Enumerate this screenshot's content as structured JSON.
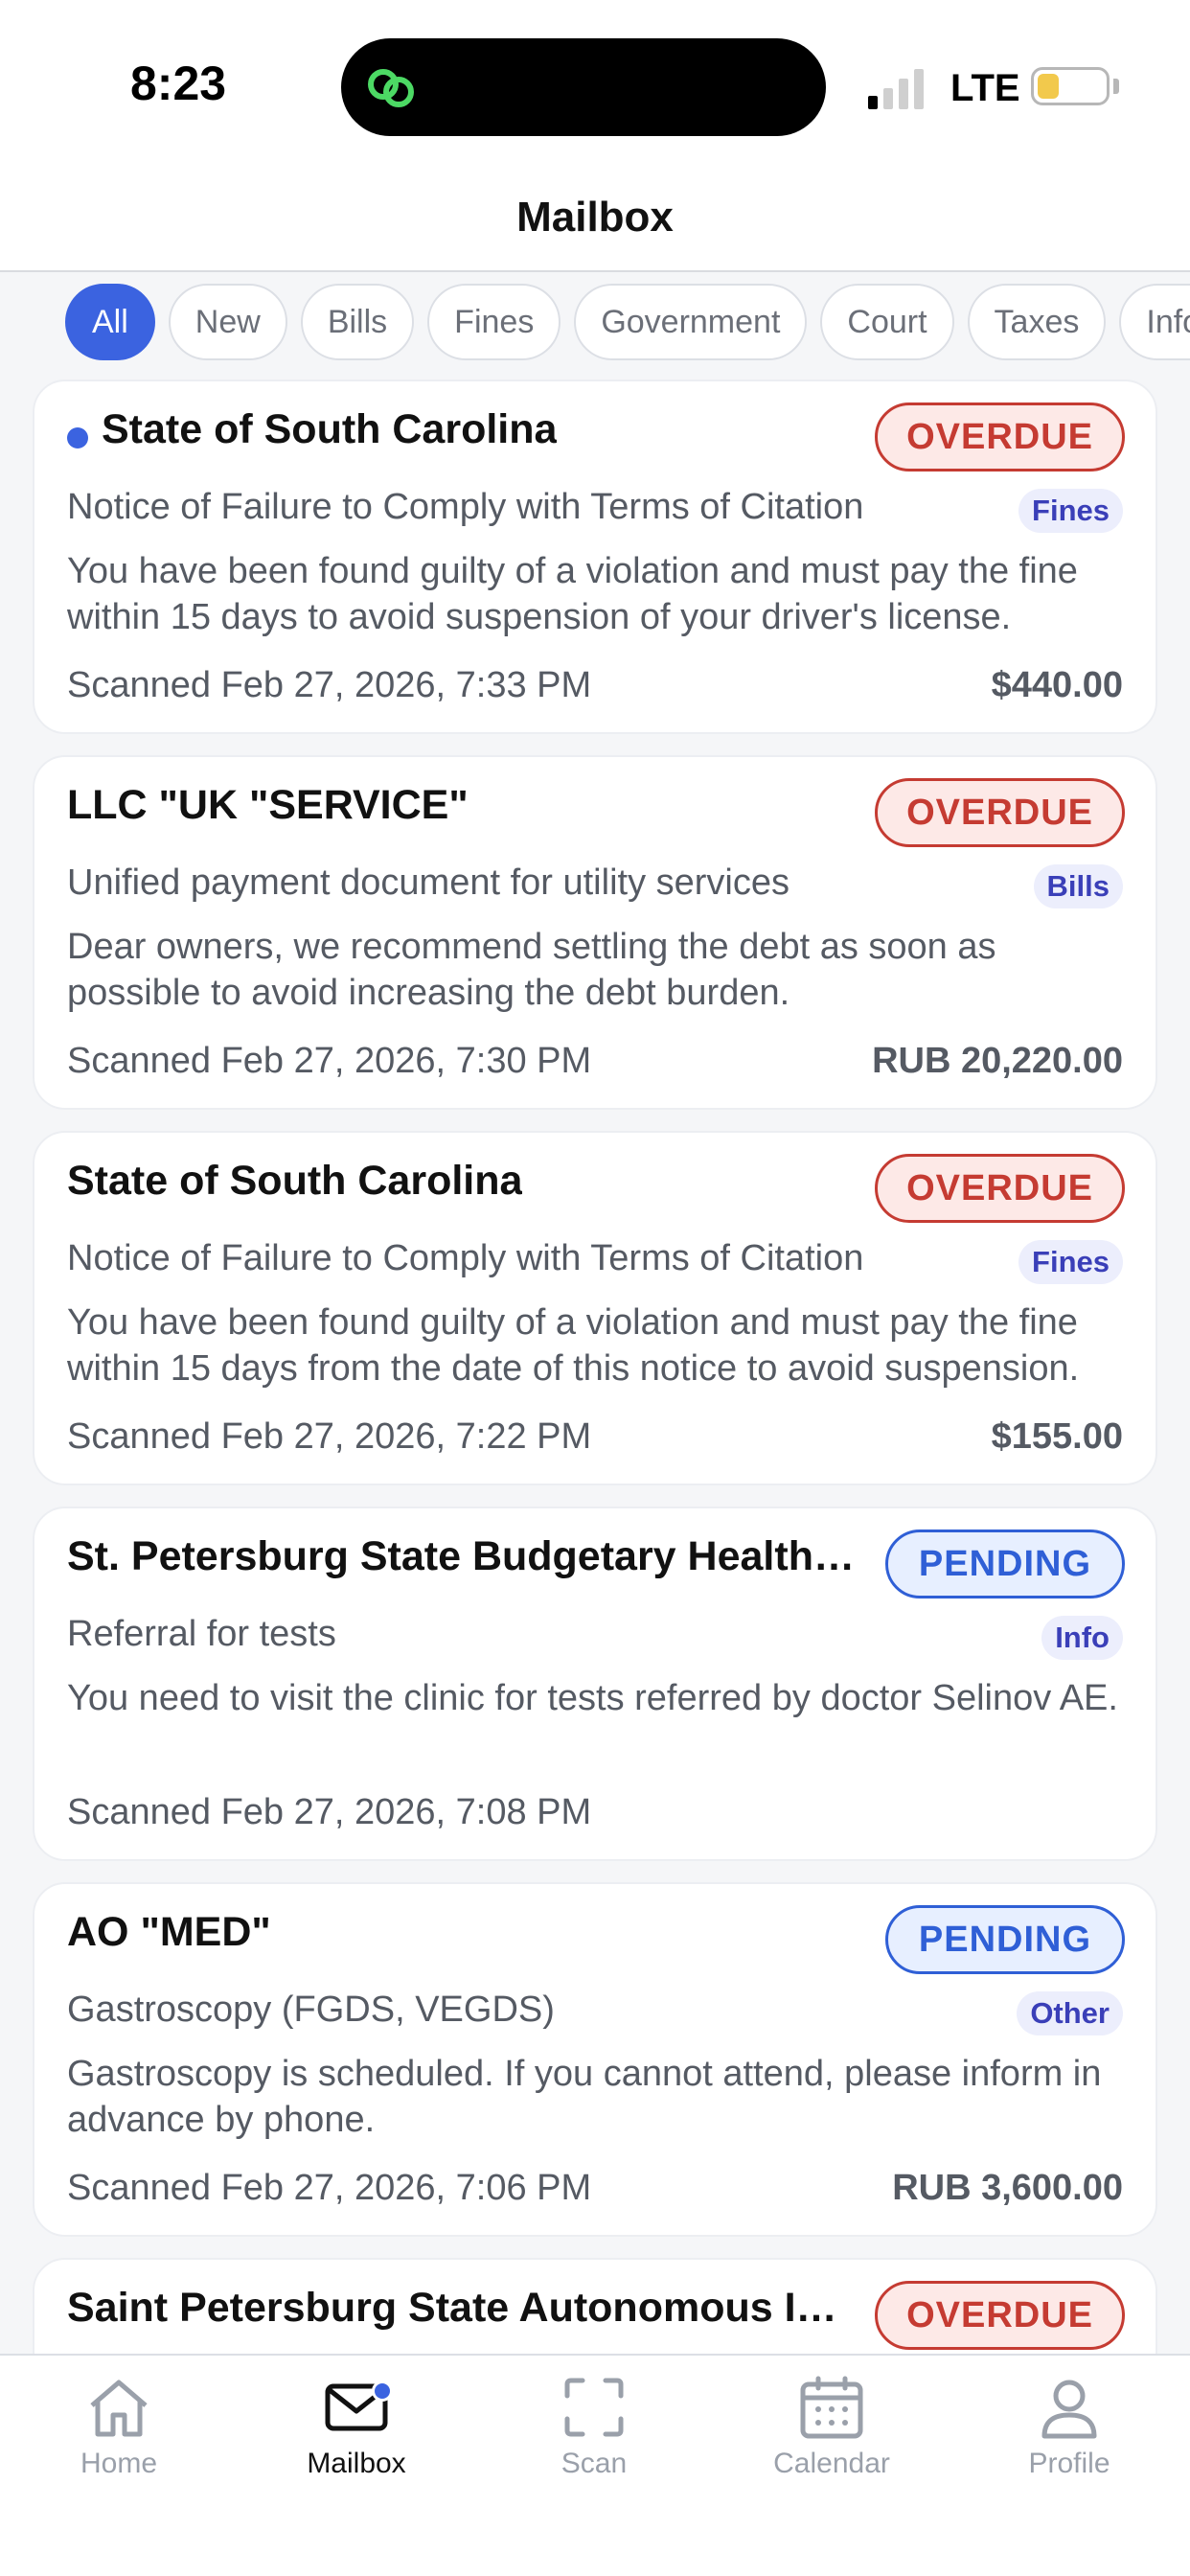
{
  "status_bar": {
    "time": "8:23",
    "network": "LTE"
  },
  "nav": {
    "title": "Mailbox"
  },
  "filters": [
    {
      "label": "All",
      "active": true
    },
    {
      "label": "New",
      "active": false
    },
    {
      "label": "Bills",
      "active": false
    },
    {
      "label": "Fines",
      "active": false
    },
    {
      "label": "Government",
      "active": false
    },
    {
      "label": "Court",
      "active": false
    },
    {
      "label": "Taxes",
      "active": false
    },
    {
      "label": "Info",
      "active": false
    }
  ],
  "messages": [
    {
      "sender": "State of South Carolina",
      "unread": true,
      "status": "OVERDUE",
      "subject": "Notice of Failure to Comply with Terms of Citation",
      "tag": "Fines",
      "body": "You have been found guilty of a violation and must pay the fine within 15 days to avoid suspension of your driver's license.",
      "date": "Scanned Feb 27, 2026, 7:33 PM",
      "amount": "$440.00"
    },
    {
      "sender": "LLC \"UK \"SERVICE\"",
      "unread": false,
      "status": "OVERDUE",
      "subject": "Unified payment document for utility services",
      "tag": "Bills",
      "body": "Dear owners, we recommend settling the debt as soon as possible to avoid increasing the debt burden.",
      "date": "Scanned Feb 27, 2026, 7:30 PM",
      "amount": "RUB 20,220.00"
    },
    {
      "sender": "State of South Carolina",
      "unread": false,
      "status": "OVERDUE",
      "subject": "Notice of Failure to Comply with Terms of Citation",
      "tag": "Fines",
      "body": "You have been found guilty of a violation and must pay the fine within 15 days from the date of this notice to avoid suspension.",
      "date": "Scanned Feb 27, 2026, 7:22 PM",
      "amount": "$155.00"
    },
    {
      "sender": "St. Petersburg State Budgetary Healthcare Institution",
      "unread": false,
      "status": "PENDING",
      "subject": "Referral for tests",
      "tag": "Info",
      "body": "You need to visit the clinic for tests referred by doctor Selinov AE.",
      "date": "Scanned Feb 27, 2026, 7:08 PM",
      "amount": ""
    },
    {
      "sender": "AO \"MED\"",
      "unread": false,
      "status": "PENDING",
      "subject": "Gastroscopy (FGDS, VEGDS)",
      "tag": "Other",
      "body": "Gastroscopy is scheduled. If you cannot attend, please inform in advance by phone.",
      "date": "Scanned Feb 27, 2026, 7:06 PM",
      "amount": "RUB 3,600.00"
    },
    {
      "sender": "Saint Petersburg State Autonomous Institution",
      "unread": false,
      "status": "OVERDUE",
      "subject": "",
      "tag": "",
      "body": "",
      "date": "",
      "amount": ""
    }
  ],
  "tabs": [
    {
      "label": "Home",
      "icon": "home-icon",
      "active": false
    },
    {
      "label": "Mailbox",
      "icon": "mail-icon",
      "active": true,
      "badge": true
    },
    {
      "label": "Scan",
      "icon": "scan-icon",
      "active": false
    },
    {
      "label": "Calendar",
      "icon": "calendar-icon",
      "active": false
    },
    {
      "label": "Profile",
      "icon": "profile-icon",
      "active": false
    }
  ],
  "colors": {
    "accent": "#3b63e0",
    "overdue": "#c53b32",
    "pending": "#2f5fd6",
    "tag_text": "#3a3fb8"
  }
}
